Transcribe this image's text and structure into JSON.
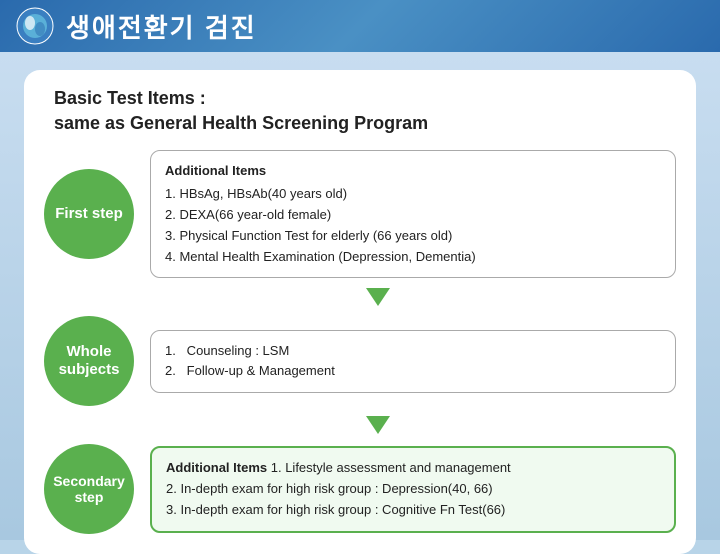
{
  "header": {
    "title": "생애전환기 검진",
    "icon_label": "health-icon"
  },
  "card": {
    "basic_test_title_line1": "Basic Test Items :",
    "basic_test_title_line2": "same as General Health Screening Program",
    "first_step_label": "First step",
    "whole_subjects_label": "Whole\nsubjects",
    "secondary_step_label": "Secondary step",
    "first_step_info": {
      "additional_title": "Additional Items",
      "items": [
        "1. HBsAg, HBsAb(40 years old)",
        "2. DEXA(66 year-old female)",
        "3. Physical Function Test for elderly (66 years old)",
        "4. Mental Health Examination (Depression, Dementia)"
      ]
    },
    "whole_subjects_info": {
      "items": [
        "1.   Counseling : LSM",
        "2.   Follow-up & Management"
      ]
    },
    "secondary_step_info": {
      "additional_title": "Additional Items",
      "items": [
        "1. Lifestyle assessment and management",
        "2. In-depth exam for high risk group : Depression(40, 66)",
        "3. In-depth exam for high risk group : Cognitive Fn Test(66)"
      ]
    }
  }
}
